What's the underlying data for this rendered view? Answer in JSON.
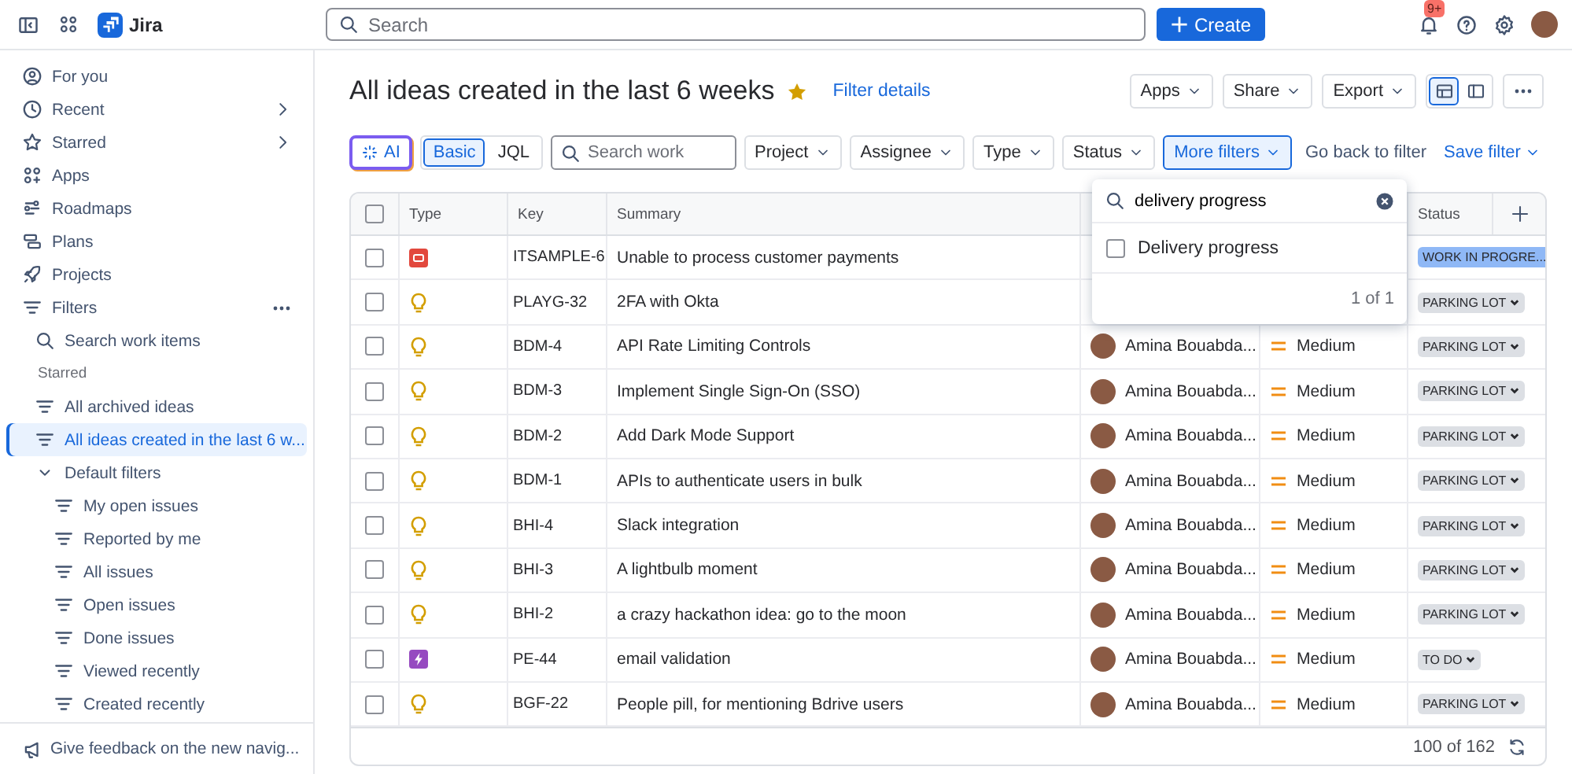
{
  "topbar": {
    "product": "Jira",
    "search_placeholder": "Search",
    "create_label": "Create",
    "notification_count": "9+"
  },
  "sidebar": {
    "items": [
      {
        "label": "For you",
        "selected": false
      },
      {
        "label": "Recent",
        "selected": false,
        "expanded": false
      },
      {
        "label": "Starred",
        "selected": false,
        "expanded": false
      },
      {
        "label": "Apps",
        "selected": false
      },
      {
        "label": "Roadmaps",
        "selected": false
      },
      {
        "label": "Plans",
        "selected": false
      },
      {
        "label": "Projects",
        "selected": false
      },
      {
        "label": "Filters",
        "selected": false,
        "has_menu": true,
        "children": [
          {
            "label": "Search work items",
            "kind": "search",
            "selected": false
          },
          {
            "label": "Starred",
            "kind": "section"
          },
          {
            "label": "All archived ideas",
            "kind": "filter",
            "selected": false
          },
          {
            "label": "All ideas created in the last 6 w...",
            "kind": "filter",
            "selected": true
          },
          {
            "label": "Default filters",
            "kind": "group",
            "selected": false,
            "expanded": true,
            "children": [
              {
                "label": "My open issues",
                "kind": "filter",
                "selected": false
              },
              {
                "label": "Reported by me",
                "kind": "filter",
                "selected": false
              },
              {
                "label": "All issues",
                "kind": "filter",
                "selected": false
              },
              {
                "label": "Open issues",
                "kind": "filter",
                "selected": false
              },
              {
                "label": "Done issues",
                "kind": "filter",
                "selected": false
              },
              {
                "label": "Viewed recently",
                "kind": "filter",
                "selected": false
              },
              {
                "label": "Created recently",
                "kind": "filter",
                "selected": false
              }
            ]
          }
        ]
      }
    ],
    "feedback": "Give feedback on the new navig..."
  },
  "page": {
    "title": "All ideas created in the last 6 weeks",
    "starred": true,
    "details_link": "Filter details",
    "actions": [
      {
        "label": "Apps"
      },
      {
        "label": "Share"
      },
      {
        "label": "Export"
      }
    ],
    "views": [
      {
        "selected": true
      },
      {
        "selected": false
      }
    ]
  },
  "filter_bar": {
    "ai_label": "AI",
    "modes": [
      {
        "label": "Basic",
        "selected": true
      },
      {
        "label": "JQL",
        "selected": false
      }
    ],
    "search_placeholder": "Search work",
    "filters": [
      {
        "label": "Project",
        "selected": false
      },
      {
        "label": "Assignee",
        "selected": false
      },
      {
        "label": "Type",
        "selected": false
      },
      {
        "label": "Status",
        "selected": false
      },
      {
        "label": "More filters",
        "selected": true
      }
    ],
    "back_link": "Go back to filter",
    "save_label": "Save filter"
  },
  "table": {
    "select_all_checked": false,
    "columns": {
      "type": "Type",
      "key": "Key",
      "summary": "Summary",
      "status": "Status"
    },
    "rows": [
      {
        "checked": false,
        "kind": "incident",
        "key": "ITSAMPLE-6",
        "summary": "Unable to process customer payments",
        "status": {
          "label": "WORK IN PROGRE...",
          "color": "#8fb8f6",
          "caret": false
        }
      },
      {
        "checked": false,
        "kind": "idea",
        "key": "PLAYG-32",
        "summary": "2FA with Okta",
        "status": {
          "label": "PARKING LOT",
          "color": "#dcdfe4",
          "caret": true
        }
      },
      {
        "checked": false,
        "kind": "idea",
        "key": "BDM-4",
        "summary": "API Rate Limiting Controls",
        "assignee": "Amina Bouabda...",
        "priority": "Medium",
        "status": {
          "label": "PARKING LOT",
          "color": "#dcdfe4",
          "caret": true
        }
      },
      {
        "checked": false,
        "kind": "idea",
        "key": "BDM-3",
        "summary": "Implement Single Sign-On (SSO)",
        "assignee": "Amina Bouabda...",
        "priority": "Medium",
        "status": {
          "label": "PARKING LOT",
          "color": "#dcdfe4",
          "caret": true
        }
      },
      {
        "checked": false,
        "kind": "idea",
        "key": "BDM-2",
        "summary": "Add Dark Mode Support",
        "assignee": "Amina Bouabda...",
        "priority": "Medium",
        "status": {
          "label": "PARKING LOT",
          "color": "#dcdfe4",
          "caret": true
        }
      },
      {
        "checked": false,
        "kind": "idea",
        "key": "BDM-1",
        "summary": "APIs to authenticate users in bulk",
        "assignee": "Amina Bouabda...",
        "priority": "Medium",
        "status": {
          "label": "PARKING LOT",
          "color": "#dcdfe4",
          "caret": true
        }
      },
      {
        "checked": false,
        "kind": "idea",
        "key": "BHI-4",
        "summary": "Slack integration",
        "assignee": "Amina Bouabda...",
        "priority": "Medium",
        "status": {
          "label": "PARKING LOT",
          "color": "#dcdfe4",
          "caret": true
        }
      },
      {
        "checked": false,
        "kind": "idea",
        "key": "BHI-3",
        "summary": "A lightbulb moment",
        "assignee": "Amina Bouabda...",
        "priority": "Medium",
        "status": {
          "label": "PARKING LOT",
          "color": "#dcdfe4",
          "caret": true
        }
      },
      {
        "checked": false,
        "kind": "idea",
        "key": "BHI-2",
        "summary": "a crazy hackathon idea: go to the moon",
        "assignee": "Amina Bouabda...",
        "priority": "Medium",
        "status": {
          "label": "PARKING LOT",
          "color": "#dcdfe4",
          "caret": true
        }
      },
      {
        "checked": false,
        "kind": "epic",
        "key": "PE-44",
        "summary": "email validation",
        "assignee": "Amina Bouabda...",
        "priority": "Medium",
        "status": {
          "label": "TO DO",
          "color": "#dcdfe4",
          "caret": true
        }
      },
      {
        "checked": false,
        "kind": "idea",
        "key": "BGF-22",
        "summary": "People pill, for mentioning Bdrive users",
        "assignee": "Amina Bouabda...",
        "priority": "Medium",
        "status": {
          "label": "PARKING LOT",
          "color": "#dcdfe4",
          "caret": true
        }
      }
    ],
    "count": "100 of 162"
  },
  "filter_dropdown": {
    "value": "delivery progress",
    "options": [
      {
        "label": "Delivery progress",
        "checked": false
      }
    ],
    "count": "1 of 1"
  }
}
